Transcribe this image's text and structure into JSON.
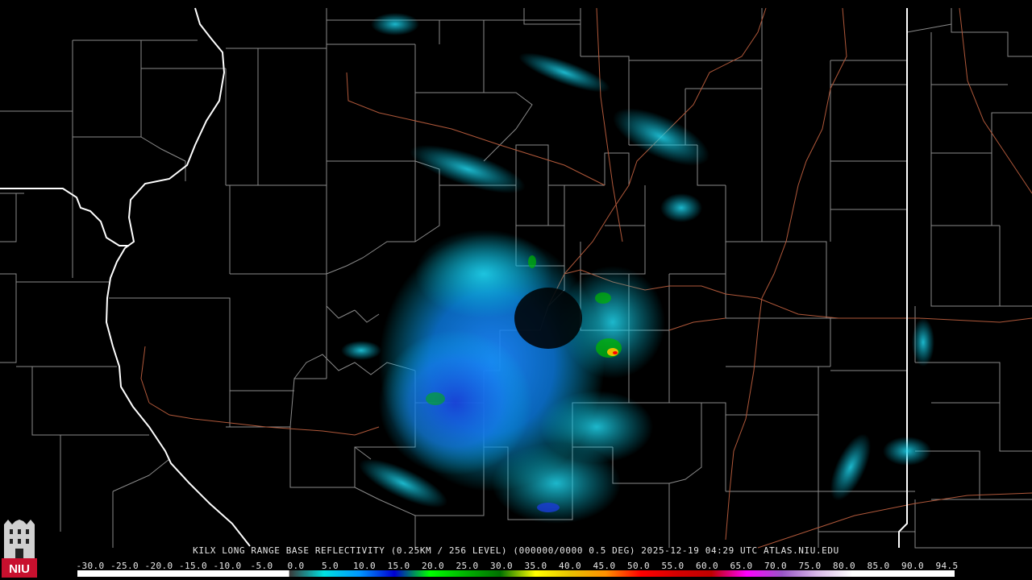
{
  "product": {
    "title": "KILX LONG RANGE BASE REFLECTIVITY (0.25KM / 256 LEVEL) (000000/0000 0.5 DEG) 2025-12-19 04:29 UTC  ATLAS.NIU.EDU"
  },
  "logo": {
    "text": "NIU",
    "color": "#c8102e"
  },
  "colors": {
    "background": "#000000",
    "county_lines": "#8a8a8a",
    "state_lines": "#ffffff",
    "highways": "#b0583a"
  },
  "color_scale": {
    "labels": [
      "-30.0",
      "-25.0",
      "-20.0",
      "-15.0",
      "-10.0",
      "-5.0",
      "0.0",
      "5.0",
      "10.0",
      "15.0",
      "20.0",
      "25.0",
      "30.0",
      "35.0",
      "40.0",
      "45.0",
      "50.0",
      "55.0",
      "60.0",
      "65.0",
      "70.0",
      "75.0",
      "80.0",
      "85.0",
      "90.0",
      "94.5"
    ],
    "stops": [
      {
        "dbz": -30,
        "color": "#ffffff"
      },
      {
        "dbz": 0,
        "color": "#ffffff"
      },
      {
        "dbz": 0.1,
        "color": "#3a3a3a"
      },
      {
        "dbz": 5,
        "color": "#00e0e0"
      },
      {
        "dbz": 10,
        "color": "#0098ff"
      },
      {
        "dbz": 15,
        "color": "#0000d0"
      },
      {
        "dbz": 20,
        "color": "#00ff00"
      },
      {
        "dbz": 25,
        "color": "#00b400"
      },
      {
        "dbz": 30,
        "color": "#007000"
      },
      {
        "dbz": 35,
        "color": "#ffff00"
      },
      {
        "dbz": 40,
        "color": "#e7c000"
      },
      {
        "dbz": 45,
        "color": "#ff9000"
      },
      {
        "dbz": 50,
        "color": "#ff0000"
      },
      {
        "dbz": 55,
        "color": "#d60000"
      },
      {
        "dbz": 60,
        "color": "#c00000"
      },
      {
        "dbz": 65,
        "color": "#ff00ff"
      },
      {
        "dbz": 70,
        "color": "#9955c9"
      },
      {
        "dbz": 75,
        "color": "#d8b8e8"
      },
      {
        "dbz": 80,
        "color": "#ffffff"
      },
      {
        "dbz": 94.5,
        "color": "#ffffff"
      }
    ]
  }
}
